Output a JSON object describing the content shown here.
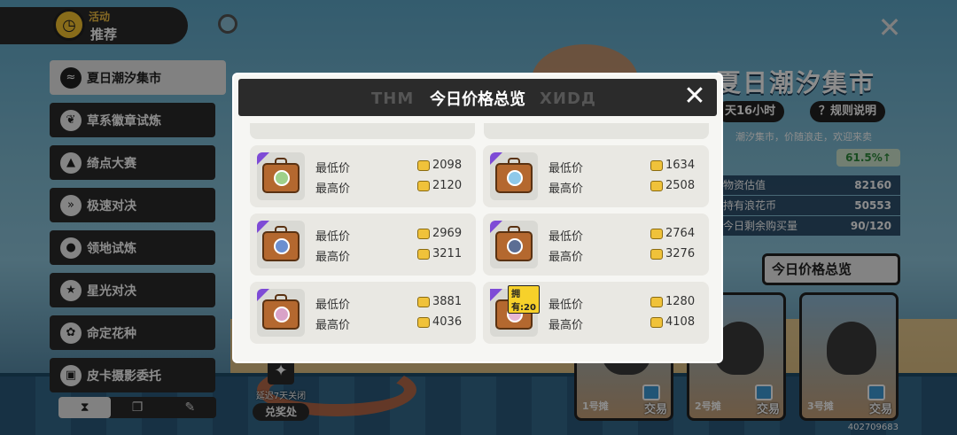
{
  "header": {
    "activity_top": "活动",
    "activity_bottom": "推荐"
  },
  "sidebar": {
    "items": [
      {
        "label": "夏日潮汐集市",
        "icon": "wave-icon",
        "active": true
      },
      {
        "label": "草系徽章试炼",
        "icon": "leaf-icon",
        "active": false
      },
      {
        "label": "绮点大赛",
        "icon": "witch-hat-icon",
        "active": false
      },
      {
        "label": "极速对决",
        "icon": "speed-icon",
        "active": false
      },
      {
        "label": "领地试炼",
        "icon": "bomb-icon",
        "active": false
      },
      {
        "label": "星光对决",
        "icon": "star-hand-icon",
        "active": false
      },
      {
        "label": "命定花种",
        "icon": "flower-icon",
        "active": false
      },
      {
        "label": "皮卡摄影委托",
        "icon": "camera-icon",
        "active": false
      }
    ],
    "tabs": [
      "hourglass-icon",
      "cards-icon",
      "feather-icon"
    ]
  },
  "redeem": {
    "note": "延迟7天关闭",
    "button": "兑奖处"
  },
  "right_panel": {
    "title": "夏日潮汐集市",
    "remaining": "天16小时",
    "rules": "？规则说明",
    "desc": "潮汐集市，价随浪走，欢迎来卖",
    "percent": "61.5%↑",
    "rows": [
      {
        "label": "物资估值",
        "value": "82160"
      },
      {
        "label": "持有浪花币",
        "value": "50553"
      },
      {
        "label": "今日剩余购买量",
        "value": "90/120"
      }
    ],
    "overview_button": "今日价格总览",
    "stalls": [
      {
        "label": "1号摊",
        "trade": "交易"
      },
      {
        "label": "2号摊",
        "trade": "交易"
      },
      {
        "label": "3号摊",
        "trade": "交易"
      }
    ]
  },
  "modal": {
    "title": "今日价格总览",
    "ghost_text": "THM",
    "ghost_text_right": "XИDД",
    "min_label": "最低价",
    "max_label": "最高价",
    "items": [
      {
        "min": "2098",
        "max": "2120",
        "owned": ""
      },
      {
        "min": "1634",
        "max": "2508",
        "owned": ""
      },
      {
        "min": "2969",
        "max": "3211",
        "owned": ""
      },
      {
        "min": "2764",
        "max": "3276",
        "owned": ""
      },
      {
        "min": "3881",
        "max": "4036",
        "owned": ""
      },
      {
        "min": "1280",
        "max": "4108",
        "owned": "拥有:20"
      }
    ]
  },
  "footer": {
    "id": "402709683"
  },
  "colors": {
    "panel_dark": "#2b2b2b",
    "rarity_purple": "#7e4bd6",
    "coin_gold": "#f0c23a",
    "percent_green": "#2d8a3b"
  }
}
